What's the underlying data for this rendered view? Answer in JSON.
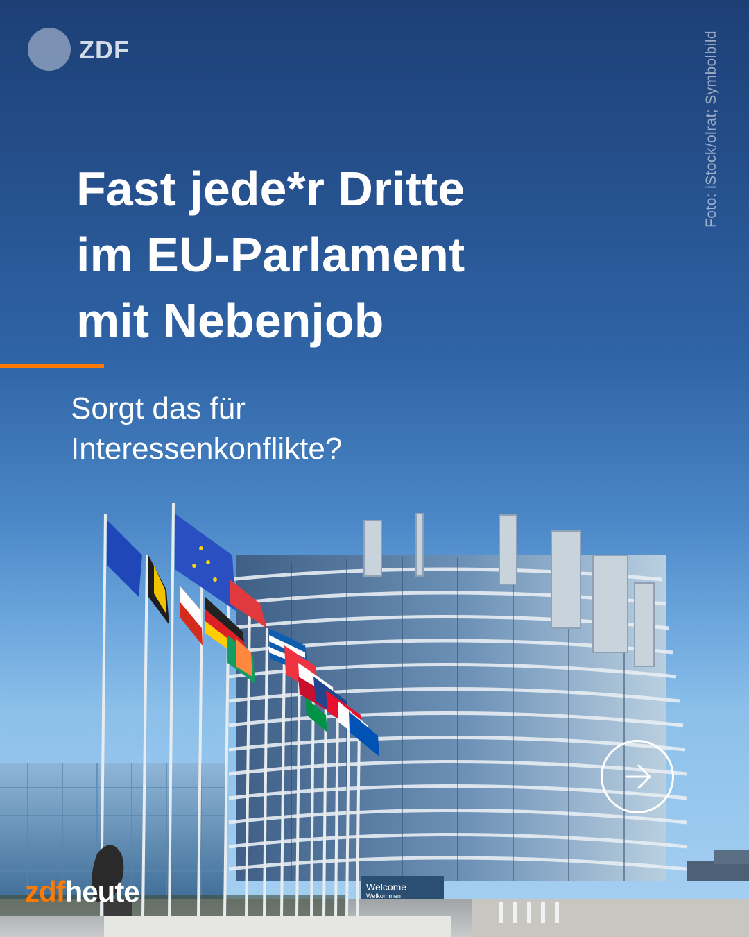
{
  "brand": {
    "top_logo": "ZDF",
    "bottom_logo_part1": "zdf",
    "bottom_logo_part2": "heute",
    "accent_color": "#ff7a00"
  },
  "photo_credit": "Foto: iStock/olrat; Symbolbild",
  "headline": {
    "lines": [
      "Fast jede*r Dritte",
      "im EU-Parlament",
      "mit Nebenjob"
    ]
  },
  "subline": {
    "lines": [
      "Sorgt das für",
      "Interessenkonflikte?"
    ]
  },
  "photo": {
    "building_signs": [
      "Welcome",
      "Welkommen"
    ]
  },
  "next_button": {
    "icon": "arrow-right-icon"
  }
}
